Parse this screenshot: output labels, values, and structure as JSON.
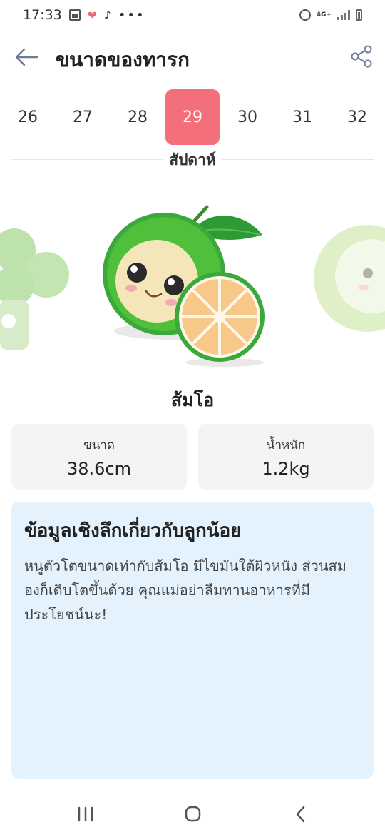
{
  "status_bar": {
    "time": "17:33",
    "dots": "•••",
    "network": "4G+"
  },
  "header": {
    "title": "ขนาดของทารก"
  },
  "weeks": {
    "items": [
      "26",
      "27",
      "28",
      "29",
      "30",
      "31",
      "32"
    ],
    "selected": "29",
    "label": "สัปดาห์"
  },
  "fruit": {
    "name": "ส้มโอ"
  },
  "stats": {
    "size_label": "ขนาด",
    "size_value": "38.6cm",
    "weight_label": "น้ำหนัก",
    "weight_value": "1.2kg"
  },
  "insight": {
    "title": "ข้อมูลเชิงลึกเกี่ยวกับลูกน้อย",
    "body": "หนูตัวโตขนาดเท่ากับส้มโอ มีไขมันใต้ผิวหนัง ส่วนสมองก็เดิบโตขึ้นด้วย คุณแม่อย่าลืมทานอาหารที่มีประโยชน์นะ!"
  },
  "colors": {
    "accent": "#f46f7c",
    "insight_bg": "#e4f2fd",
    "card_bg": "#f3f4f6"
  }
}
